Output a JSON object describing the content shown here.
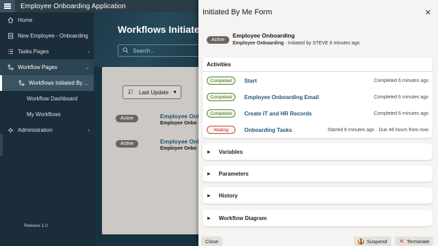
{
  "app": {
    "title": "Employee Onboarding Application"
  },
  "sidebar": {
    "items": [
      {
        "label": "Home",
        "icon": "home-icon"
      },
      {
        "label": "New Employee - Onboarding",
        "icon": "form-icon"
      },
      {
        "label": "Tasks Pages",
        "icon": "list-icon"
      },
      {
        "label": "Workflow Pages",
        "icon": "workflow-icon"
      },
      {
        "label": "Workflows Initiated By ..."
      },
      {
        "label": "Workflow Dashboard"
      },
      {
        "label": "My Workflows"
      },
      {
        "label": "Administration",
        "icon": "gear-icon"
      }
    ]
  },
  "main": {
    "title": "Workflows Initiate",
    "search_placeholder": "Search...",
    "sort_label": "Last Update",
    "rows": [
      {
        "badge": "Active",
        "name": "Employee Onb",
        "sub": "Employee Onbo"
      },
      {
        "badge": "Active",
        "name": "Employee Onb",
        "sub": "Employee Onbo"
      }
    ],
    "release": "Release 1.0"
  },
  "drawer": {
    "title": "Initiated By Me Form",
    "summary": {
      "badge": "Active",
      "title": "Employee Onboarding",
      "sub_name": "Employee Onboarding",
      "sub_rest": " · Initiated by STEVE 6 minutes ago"
    },
    "activities_title": "Activities",
    "activities": [
      {
        "status": "Completed",
        "name": "Start",
        "time": "Completed 6 minutes ago"
      },
      {
        "status": "Completed",
        "name": "Employee Onboarding Email",
        "time": "Completed 6 minutes ago"
      },
      {
        "status": "Completed",
        "name": "Create IT and HR Records",
        "time": "Completed 6 minutes ago"
      },
      {
        "status": "Waiting",
        "name": "Onboarding Tasks",
        "time": "Started 6 minutes ago · Due 48 hours from now"
      }
    ],
    "sections": [
      "Variables",
      "Parameters",
      "History",
      "Workflow Diagram"
    ],
    "buttons": {
      "close": "Close",
      "suspend": "Suspend",
      "terminate": "Terminate"
    }
  },
  "colors": {
    "link": "#1f5678",
    "completed": "#508223",
    "waiting": "#c74634",
    "topbar": "#2b3c46"
  }
}
